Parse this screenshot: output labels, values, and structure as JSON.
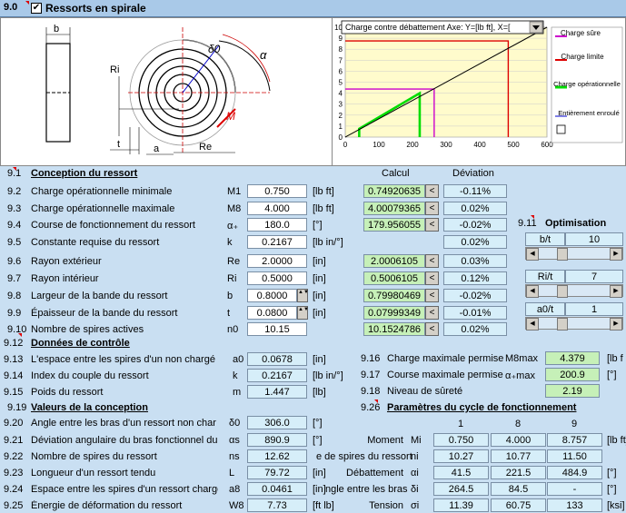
{
  "header": {
    "num": "9.0",
    "title": "Ressorts en spirale",
    "checked": "✔"
  },
  "drawing": {
    "labels": {
      "b": "b",
      "ri": "Ri",
      "delta": "δ0",
      "alpha": "α",
      "m": "M",
      "t": "t",
      "a": "a",
      "re": "Re"
    }
  },
  "chart": {
    "title_box": "Charge contre débattement  Axe: Y=[lb ft], X=[",
    "dropdown_icon": "triangle-down",
    "legend": [
      "Charge sûre",
      "Charge limite",
      "Charge opérationnelle",
      "Entièrement enroulé"
    ],
    "colors": {
      "safe": "#cc00cc",
      "limit": "#dd0000",
      "oper": "#00dd00",
      "full": "#000000"
    }
  },
  "chart_data": {
    "type": "line",
    "xlim": [
      0,
      600
    ],
    "ylim": [
      0,
      10
    ],
    "xticks": [
      "0",
      "100",
      "200",
      "300",
      "400",
      "500",
      "600"
    ],
    "yticks": [
      "0",
      "1",
      "2",
      "3",
      "4",
      "5",
      "6",
      "7",
      "8",
      "9",
      "10"
    ],
    "series": [
      {
        "name": "Charge sûre",
        "points": [
          [
            0,
            4.379
          ],
          [
            264.5,
            4.379
          ],
          [
            264.5,
            0
          ]
        ]
      },
      {
        "name": "Charge limite",
        "points": [
          [
            0,
            8.757
          ],
          [
            484.9,
            8.757
          ],
          [
            484.9,
            0
          ]
        ]
      },
      {
        "name": "Charge opérationnelle",
        "points": [
          [
            41.5,
            0
          ],
          [
            41.5,
            0.75
          ],
          [
            221.5,
            4.0
          ],
          [
            221.5,
            0
          ]
        ]
      },
      {
        "name": "",
        "points": [
          [
            0,
            0
          ],
          [
            600,
            10.8
          ]
        ]
      }
    ]
  },
  "design": {
    "num": "9.1",
    "title": "Conception du ressort",
    "calc_header": "Calcul",
    "dev_header": "Déviation",
    "rows": [
      {
        "num": "9.2",
        "label": "Charge opérationnelle minimale",
        "sym": "M1",
        "value": "0.750",
        "unit": "[lb ft]",
        "calc": "0.74920635",
        "dev": "-0.11%"
      },
      {
        "num": "9.3",
        "label": "Charge opérationnelle maximale",
        "sym": "M8",
        "value": "4.000",
        "unit": "[lb ft]",
        "calc": "4.00079365",
        "dev": "0.02%"
      },
      {
        "num": "9.4",
        "label": "Course de fonctionnement du ressort",
        "sym": "α₊",
        "value": "180.0",
        "unit": "[°]",
        "calc": "179.956055",
        "dev": "-0.02%"
      },
      {
        "num": "9.5",
        "label": "Constante requise du ressort",
        "sym": "k",
        "value": "0.2167",
        "unit": "[lb in/°]",
        "calc": "",
        "dev": "0.02%"
      },
      {
        "num": "9.6",
        "label": "Rayon extérieur",
        "sym": "Re",
        "value": "2.0000",
        "unit": "[in]",
        "calc": "2.0006105",
        "dev": "0.03%"
      },
      {
        "num": "9.7",
        "label": "Rayon intérieur",
        "sym": "Ri",
        "value": "0.5000",
        "unit": "[in]",
        "calc": "0.5006105",
        "dev": "0.12%"
      },
      {
        "num": "9.8",
        "label": "Largeur de la bande du ressort",
        "sym": "b",
        "value": "0.8000",
        "unit": "[in]",
        "calc": "0.79980469",
        "dev": "-0.02%"
      },
      {
        "num": "9.9",
        "label": "Épaisseur de la bande du ressort",
        "sym": "t",
        "value": "0.0800",
        "unit": "[in]",
        "calc": "0.07999349",
        "dev": "-0.01%"
      },
      {
        "num": "9.10",
        "label": "Nombre de spires actives",
        "sym": "n0",
        "value": "10.15",
        "unit": "",
        "calc": "10.1524786",
        "dev": "0.02%"
      }
    ]
  },
  "optim": {
    "num": "9.11",
    "title": "Optimisation",
    "items": [
      {
        "label": "b/t",
        "value": "10"
      },
      {
        "label": "Ri/t",
        "value": "7"
      },
      {
        "label": "a0/t",
        "value": "1"
      }
    ]
  },
  "control": {
    "num": "9.12",
    "title": "Données de contrôle",
    "rows": [
      {
        "num": "9.13",
        "label": "L'espace entre les spires d'un non chargé",
        "sym": "a0",
        "value": "0.0678",
        "unit": "[in]"
      },
      {
        "num": "9.14",
        "label": "Index du couple du ressort",
        "sym": "k",
        "value": "0.2167",
        "unit": "[lb in/°]"
      },
      {
        "num": "9.15",
        "label": "Poids du ressort",
        "sym": "m",
        "value": "1.447",
        "unit": "[lb]"
      }
    ],
    "right": [
      {
        "num": "9.16",
        "label": "Charge maximale permise",
        "sym": "M8max",
        "value": "4.379",
        "unit": "[lb f"
      },
      {
        "num": "9.17",
        "label": "Course maximale permise",
        "sym": "α₊max",
        "value": "200.9",
        "unit": "[°]"
      },
      {
        "num": "9.18",
        "label": "Niveau de sûreté",
        "sym": "",
        "value": "2.19",
        "unit": ""
      }
    ]
  },
  "design_values": {
    "num": "9.19",
    "title": "Valeurs de la conception",
    "rows": [
      {
        "num": "9.20",
        "label": "Angle entre les bras d'un ressort non char",
        "sym": "δ0",
        "value": "306.0",
        "unit": "[°]"
      },
      {
        "num": "9.21",
        "label": "Déviation angulaire du bras fonctionnel du",
        "sym": "αs",
        "value": "890.9",
        "unit": "[°]"
      },
      {
        "num": "9.22",
        "label": "Nombre de spires du ressort",
        "sym": "ns",
        "value": "12.62",
        "unit": ""
      },
      {
        "num": "9.23",
        "label": "Longueur d'un ressort tendu",
        "sym": "L",
        "value": "79.72",
        "unit": "[in]"
      },
      {
        "num": "9.24",
        "label": "Espace entre les spires d'un ressort chargé",
        "sym": "a8",
        "value": "0.0461",
        "unit": "[in]"
      },
      {
        "num": "9.25",
        "label": "Énergie de déformation du ressort",
        "sym": "W8",
        "value": "7.73",
        "unit": "[ft lb]"
      }
    ]
  },
  "cycle": {
    "num": "9.26",
    "title": "Paramètres du cycle de fonctionnement",
    "cols": [
      "1",
      "8",
      "9"
    ],
    "overlap": [
      "e de spires du ressort",
      "ngle entre les bras"
    ],
    "rows": [
      {
        "label": "Moment",
        "sym": "Mi",
        "v": [
          "0.750",
          "4.000",
          "8.757"
        ],
        "unit": "[lb ft]"
      },
      {
        "label": "",
        "sym": "ni",
        "v": [
          "10.27",
          "10.77",
          "11.50"
        ],
        "unit": ""
      },
      {
        "label": "Débattement",
        "sym": "αi",
        "v": [
          "41.5",
          "221.5",
          "484.9"
        ],
        "unit": "[°]"
      },
      {
        "label": "",
        "sym": "δi",
        "v": [
          "264.5",
          "84.5",
          "-"
        ],
        "unit": "[°]"
      },
      {
        "label": "Tension",
        "sym": "σi",
        "v": [
          "11.39",
          "60.75",
          "133"
        ],
        "unit": "[ksi]"
      }
    ]
  }
}
